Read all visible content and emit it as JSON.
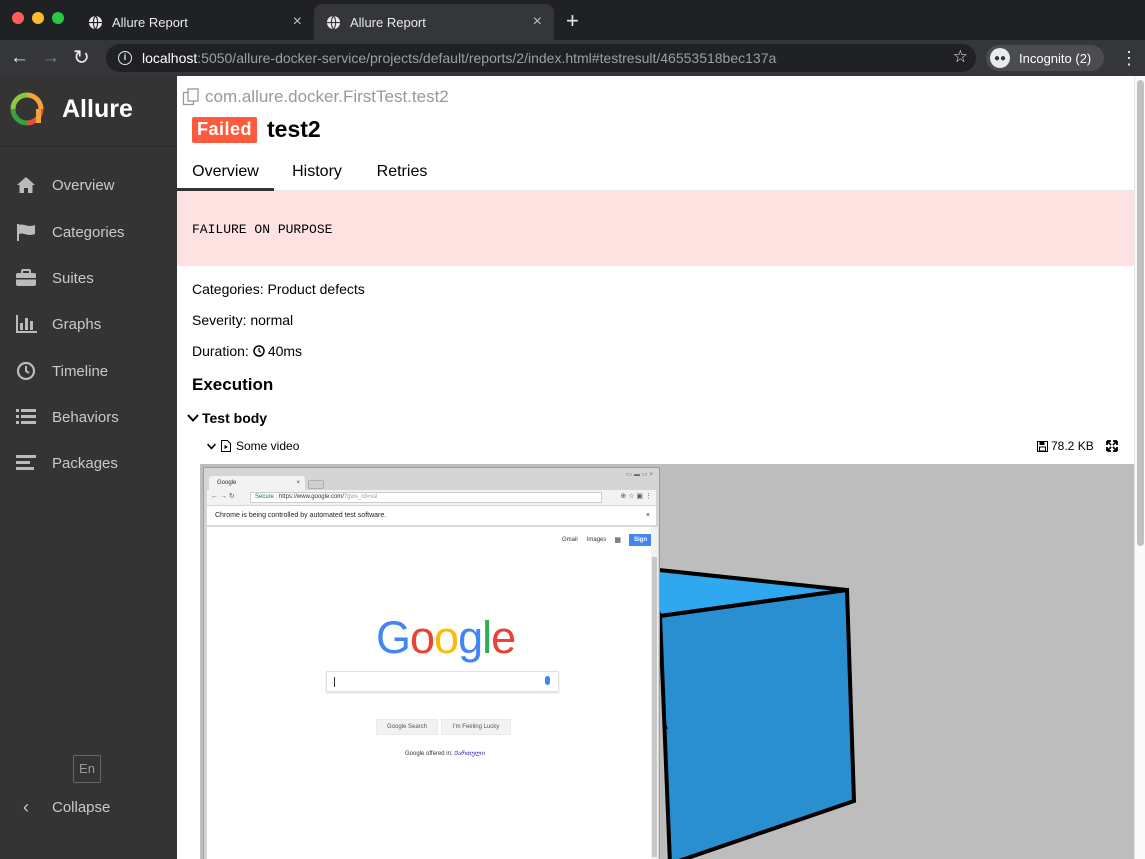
{
  "browser": {
    "tabs": [
      {
        "title": "Allure Report",
        "close": "×"
      },
      {
        "title": "Allure Report",
        "close": "×"
      }
    ],
    "new_tab": "+",
    "url_host": "localhost",
    "url_rest": ":5050/allure-docker-service/projects/default/reports/2/index.html#testresult/46553518bec137a",
    "profile": "Incognito (2)",
    "colors": {
      "active_tab": "#35363a",
      "frame": "#202124"
    }
  },
  "sidebar": {
    "brand": "Allure",
    "items": [
      {
        "label": "Overview",
        "icon": "home-icon"
      },
      {
        "label": "Categories",
        "icon": "flag-icon"
      },
      {
        "label": "Suites",
        "icon": "briefcase-icon"
      },
      {
        "label": "Graphs",
        "icon": "bar-chart-icon"
      },
      {
        "label": "Timeline",
        "icon": "clock-icon"
      },
      {
        "label": "Behaviors",
        "icon": "list-icon"
      },
      {
        "label": "Packages",
        "icon": "align-left-icon"
      }
    ],
    "language": "En",
    "collapse": "Collapse"
  },
  "testresult": {
    "full_name": "com.allure.docker.FirstTest.test2",
    "status": "Failed",
    "name": "test2",
    "tabs": [
      "Overview",
      "History",
      "Retries"
    ],
    "active_tab": "Overview",
    "failure_message": "FAILURE ON PURPOSE",
    "categories_label": "Categories:",
    "categories_value": "Product defects",
    "severity_label": "Severity:",
    "severity_value": "normal",
    "duration_label": "Duration:",
    "duration_value": "40ms",
    "execution_heading": "Execution",
    "test_body": "Test body",
    "attachment_name": "Some video",
    "attachment_size": "78.2 KB",
    "colors": {
      "failed": "#fd5a3e",
      "failure_bg": "#fde2e1",
      "sidebar": "#343434"
    }
  },
  "video_frame": {
    "tab_title": "Google",
    "secure": "Secure",
    "url_main": "https://www.google.com/",
    "url_tail": "?gws_rd=ssl",
    "infobar": "Chrome is being controlled by automated test software.",
    "gmail": "Gmail",
    "images": "Images",
    "sign_in": "Sign",
    "logo_letters": [
      "G",
      "o",
      "o",
      "g",
      "l",
      "e"
    ],
    "logo_colors": [
      "#4285f4",
      "#ea4335",
      "#fbbc05",
      "#4285f4",
      "#34a853",
      "#ea4335"
    ],
    "search_button": "Google Search",
    "lucky_button": "I'm Feeling Lucky",
    "offered_in": "Google offered in:",
    "offered_lang": "Ქართული"
  }
}
